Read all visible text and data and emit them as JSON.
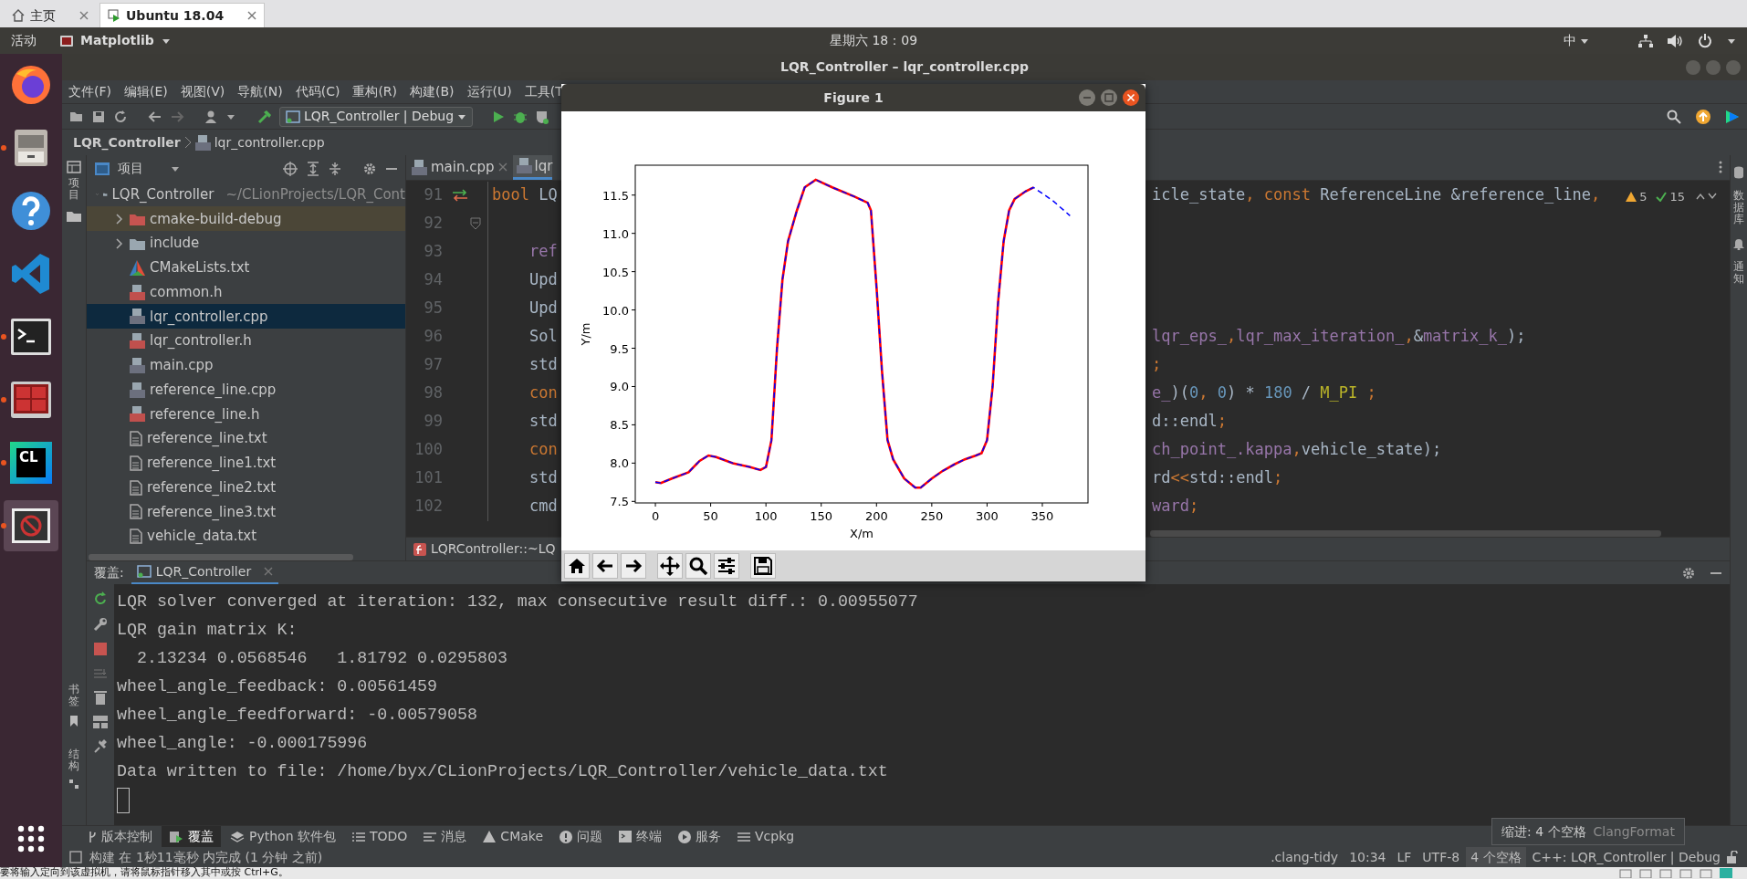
{
  "browser_tabs": [
    {
      "label": "主页",
      "selected": false
    },
    {
      "label": "Ubuntu 18.04",
      "selected": true
    }
  ],
  "top_bar": {
    "activities": "活动",
    "app_menu": "Matplotlib",
    "clock": "星期六 18：09",
    "input_method": "中"
  },
  "dock": {
    "items": [
      {
        "running": false,
        "active": false
      },
      {
        "running": true,
        "active": false
      },
      {
        "running": false,
        "active": false
      },
      {
        "running": false,
        "active": false
      },
      {
        "running": true,
        "active": false
      },
      {
        "running": true,
        "active": false
      },
      {
        "running": true,
        "active": false,
        "logo_text": "CL"
      },
      {
        "running": true,
        "active": true
      }
    ]
  },
  "ide": {
    "title": "LQR_Controller – lqr_controller.cpp",
    "menu": [
      "文件(F)",
      "编辑(E)",
      "视图(V)",
      "导航(N)",
      "代码(C)",
      "重构(R)",
      "构建(B)",
      "运行(U)",
      "工具(T"
    ],
    "run_config": "LQR_Controller | Debug",
    "breadcrumb": [
      "LQR_Controller",
      "lqr_controller.cpp"
    ],
    "left_tabs": [
      "项目"
    ],
    "right_tabs": [
      "数据库",
      "通知"
    ],
    "bottom_left_tabs": [
      "书签",
      "结构"
    ],
    "project_panel": {
      "title": "项目",
      "tree": [
        {
          "label": "LQR_Controller",
          "hint": "~/CLionProjects/LQR_Cont",
          "kind": "folder",
          "expanded": true,
          "selected": false,
          "children": [
            {
              "label": "cmake-build-debug",
              "kind": "build-folder",
              "expanded": false,
              "selected": false
            },
            {
              "label": "include",
              "kind": "folder",
              "expanded": false,
              "selected": false
            },
            {
              "label": "CMakeLists.txt",
              "kind": "cmake",
              "selected": false
            },
            {
              "label": "common.h",
              "kind": "header",
              "selected": false
            },
            {
              "label": "lqr_controller.cpp",
              "kind": "source",
              "selected": true
            },
            {
              "label": "lqr_controller.h",
              "kind": "header",
              "selected": false
            },
            {
              "label": "main.cpp",
              "kind": "source",
              "selected": false
            },
            {
              "label": "reference_line.cpp",
              "kind": "source",
              "selected": false
            },
            {
              "label": "reference_line.h",
              "kind": "header",
              "selected": false
            },
            {
              "label": "reference_line.txt",
              "kind": "text",
              "selected": false
            },
            {
              "label": "reference_line1.txt",
              "kind": "text",
              "selected": false
            },
            {
              "label": "reference_line2.txt",
              "kind": "text",
              "selected": false
            },
            {
              "label": "reference_line3.txt",
              "kind": "text",
              "selected": false
            },
            {
              "label": "vehicle_data.txt",
              "kind": "text",
              "selected": false
            }
          ]
        }
      ]
    },
    "editor": {
      "tabs": [
        {
          "label": "main.cpp",
          "selected": false
        },
        {
          "label": "lqr",
          "selected": true
        }
      ],
      "inspections": {
        "warnings": "5",
        "passed": "15"
      },
      "lines": [
        {
          "number": "91",
          "left": [
            {
              "kind": "keyword",
              "text": "bool"
            },
            {
              "kind": "plain",
              "text": " LQ"
            }
          ],
          "right": [
            {
              "kind": "plain",
              "text": "icle_state"
            },
            {
              "kind": "keyword",
              "text": ", const"
            },
            {
              "kind": "plain",
              "text": " ReferenceLine &reference_line"
            },
            {
              "kind": "keyword",
              "text": ","
            }
          ]
        },
        {
          "number": "92"
        },
        {
          "number": "93",
          "left": [
            {
              "kind": "member",
              "text": "    ref"
            }
          ]
        },
        {
          "number": "94",
          "left": [
            {
              "kind": "plain",
              "text": "    Upd"
            }
          ]
        },
        {
          "number": "95",
          "left": [
            {
              "kind": "plain",
              "text": "    Upd"
            }
          ]
        },
        {
          "number": "96",
          "left": [
            {
              "kind": "plain",
              "text": "    Sol"
            }
          ],
          "right": [
            {
              "kind": "member",
              "text": "lqr_eps_"
            },
            {
              "kind": "keyword",
              "text": ","
            },
            {
              "kind": "member",
              "text": "lqr_max_iteration_"
            },
            {
              "kind": "keyword",
              "text": ","
            },
            {
              "kind": "plain",
              "text": "&"
            },
            {
              "kind": "member",
              "text": "matrix_k_"
            },
            {
              "kind": "plain",
              "text": ");"
            }
          ]
        },
        {
          "number": "97",
          "left": [
            {
              "kind": "plain",
              "text": "    std"
            }
          ],
          "right": [
            {
              "kind": "keyword",
              "text": ";"
            }
          ]
        },
        {
          "number": "98",
          "left": [
            {
              "kind": "keyword",
              "text": "    con"
            }
          ],
          "right": [
            {
              "kind": "member",
              "text": "e_"
            },
            {
              "kind": "plain",
              "text": ")("
            },
            {
              "kind": "number",
              "text": "0"
            },
            {
              "kind": "keyword",
              "text": ","
            },
            {
              "kind": "number",
              "text": " 0"
            },
            {
              "kind": "plain",
              "text": ") * "
            },
            {
              "kind": "number",
              "text": "180"
            },
            {
              "kind": "plain",
              "text": " / "
            },
            {
              "kind": "macro",
              "text": "M_PI"
            },
            {
              "kind": "keyword",
              "text": " ;"
            }
          ]
        },
        {
          "number": "99",
          "left": [
            {
              "kind": "plain",
              "text": "    std"
            }
          ],
          "right": [
            {
              "kind": "plain",
              "text": "d::endl"
            },
            {
              "kind": "keyword",
              "text": ";"
            }
          ]
        },
        {
          "number": "100",
          "left": [
            {
              "kind": "keyword",
              "text": "    con"
            }
          ],
          "right": [
            {
              "kind": "member",
              "text": "ch_point_.kappa"
            },
            {
              "kind": "keyword",
              "text": ","
            },
            {
              "kind": "plain",
              "text": "vehicle_state);"
            }
          ]
        },
        {
          "number": "101",
          "left": [
            {
              "kind": "plain",
              "text": "    std"
            }
          ],
          "right": [
            {
              "kind": "plain",
              "text": "rd"
            },
            {
              "kind": "keyword",
              "text": "<<"
            },
            {
              "kind": "plain",
              "text": "std::endl"
            },
            {
              "kind": "keyword",
              "text": ";"
            }
          ]
        },
        {
          "number": "102",
          "left": [
            {
              "kind": "plain",
              "text": "    cmd"
            }
          ],
          "right": [
            {
              "kind": "member",
              "text": "ward"
            },
            {
              "kind": "keyword",
              "text": ";"
            }
          ]
        }
      ],
      "breadcrumb": "LQRController::~LQ"
    },
    "run_panel": {
      "label": "覆盖:",
      "tab": "LQR_Controller",
      "output": [
        "LQR solver converged at iteration: 132, max consecutive result diff.: 0.00955077",
        "LQR gain matrix K:",
        "  2.13234 0.0568546   1.81792 0.0295803",
        "wheel_angle_feedback: 0.00561459",
        "wheel_angle_feedforward: -0.00579058",
        "wheel_angle: -0.000175996",
        "Data written to file: /home/byx/CLionProjects/LQR_Controller/vehicle_data.txt"
      ]
    },
    "tool_tabs": [
      {
        "label": "版本控制",
        "selected": false
      },
      {
        "label": "覆盖",
        "selected": true
      },
      {
        "label": "Python 软件包",
        "selected": false
      },
      {
        "label": "TODO",
        "selected": false
      },
      {
        "label": "消息",
        "selected": false
      },
      {
        "label": "CMake",
        "selected": false
      },
      {
        "label": "问题",
        "selected": false
      },
      {
        "label": "终端",
        "selected": false
      },
      {
        "label": "服务",
        "selected": false
      },
      {
        "label": "Vcpkg",
        "selected": false
      }
    ],
    "status_bar": {
      "message": "构建 在 1秒11毫秒 内完成 (1 分钟 之前)",
      "items": [
        {
          "label": ".clang-tidy",
          "selected": false
        },
        {
          "label": "10:34",
          "selected": false
        },
        {
          "label": "LF",
          "selected": false
        },
        {
          "label": "UTF-8",
          "selected": false
        },
        {
          "label": "4 个空格",
          "selected": true
        },
        {
          "label": "C++: LQR_Controller | Debug",
          "selected": false
        }
      ],
      "tooltip": {
        "label": "缩进: 4 个空格",
        "hint": "ClangFormat"
      }
    }
  },
  "figure": {
    "title": "Figure 1",
    "chart_data": {
      "type": "line",
      "xlabel": "X/m",
      "ylabel": "Y/m",
      "x": [
        0,
        5,
        15,
        30,
        40,
        48,
        55,
        70,
        85,
        95,
        100,
        105,
        110,
        115,
        120,
        128,
        135,
        145,
        160,
        180,
        192,
        195,
        200,
        205,
        210,
        215,
        225,
        235,
        240,
        250,
        260,
        270,
        280,
        290,
        295,
        300,
        305,
        310,
        315,
        320,
        325,
        335,
        342,
        350,
        360,
        375
      ],
      "series": [
        {
          "color": "#ff0000",
          "line_style": "solid",
          "values": [
            7.75,
            7.74,
            7.8,
            7.88,
            8.03,
            8.1,
            8.08,
            8.0,
            7.95,
            7.91,
            7.95,
            8.3,
            9.5,
            10.4,
            10.9,
            11.3,
            11.6,
            11.7,
            11.6,
            11.48,
            11.4,
            11.3,
            10.3,
            9.2,
            8.3,
            8.05,
            7.8,
            7.68,
            7.68,
            7.8,
            7.9,
            7.98,
            8.05,
            8.1,
            8.13,
            8.3,
            9.0,
            10.1,
            10.9,
            11.3,
            11.45,
            11.55,
            11.6,
            null,
            null,
            null
          ]
        },
        {
          "color": "#0000ff",
          "line_style": "dashed",
          "values": [
            7.75,
            7.74,
            7.8,
            7.88,
            8.03,
            8.1,
            8.08,
            8.0,
            7.95,
            7.91,
            7.95,
            8.3,
            9.5,
            10.4,
            10.9,
            11.3,
            11.6,
            11.7,
            11.6,
            11.48,
            11.4,
            11.3,
            10.3,
            9.2,
            8.3,
            8.05,
            7.8,
            7.68,
            7.68,
            7.8,
            7.9,
            7.98,
            8.05,
            8.1,
            8.13,
            8.3,
            9.0,
            10.1,
            10.9,
            11.3,
            11.45,
            11.55,
            11.6,
            11.52,
            11.42,
            11.23
          ]
        }
      ],
      "xlim": [
        -18.2,
        391.3
      ],
      "ylim": [
        7.48,
        11.89
      ],
      "xticks": [
        0,
        50,
        100,
        150,
        200,
        250,
        300,
        350
      ],
      "yticks": [
        {
          "value": 7.5,
          "label": "7.5"
        },
        {
          "value": 8,
          "label": "8.0"
        },
        {
          "value": 8.5,
          "label": "8.5"
        },
        {
          "value": 9,
          "label": "9.0"
        },
        {
          "value": 9.5,
          "label": "9.5"
        },
        {
          "value": 10,
          "label": "10.0"
        },
        {
          "value": 10.5,
          "label": "10.5"
        },
        {
          "value": 11,
          "label": "11.0"
        },
        {
          "value": 11.5,
          "label": "11.5"
        }
      ]
    }
  },
  "vm_hint": "要将输入定向到该虚拟机，请将鼠标指针移入其中或按 Ctrl+G。"
}
